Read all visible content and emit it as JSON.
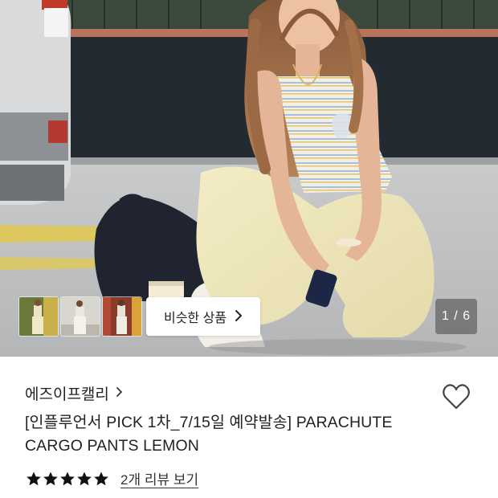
{
  "gallery": {
    "counter": "1 / 6",
    "similar_button_label": "비슷한 상품",
    "similar_button_icon": "chevron-right-icon",
    "thumbnails": [
      "thumbnail-1",
      "thumbnail-2",
      "thumbnail-3"
    ]
  },
  "product": {
    "brand": "에즈이프캘리",
    "brand_chevron": "›",
    "title_line1": "[인플루언서 PICK 1차_7/15일 예약발송] PARACHUTE",
    "title_line2": "CARGO PANTS LEMON",
    "rating_stars": 5,
    "review_link": "2개 리뷰 보기",
    "wishlist_icon": "heart-outline-icon"
  },
  "colors": {
    "text": "#222222",
    "star": "#111111",
    "counter_bg": "#464646"
  }
}
